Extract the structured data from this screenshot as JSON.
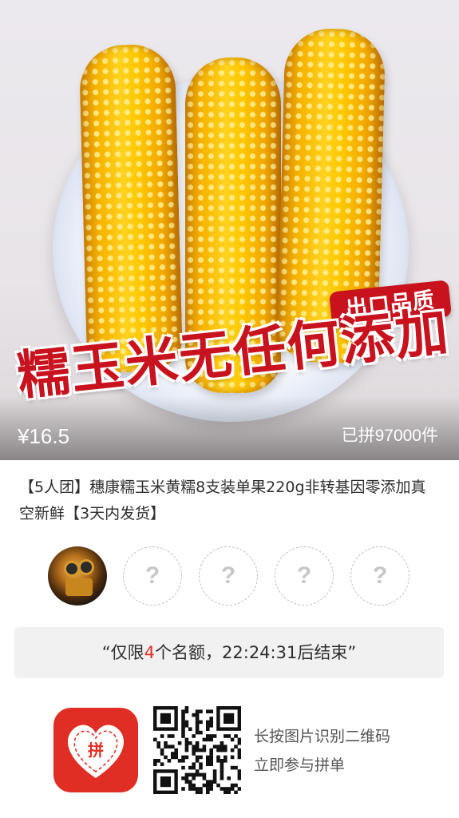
{
  "product": {
    "image_overlay": {
      "badge": "出口品质",
      "slogan": "糯玉米无任何添加"
    },
    "price": "¥16.5",
    "sold_count": "已拼97000件",
    "title": "【5人团】穗康糯玉米黄糯8支装单果220g非转基因零添加真空新鲜【3天内发货】"
  },
  "group": {
    "members": [
      {
        "type": "avatar",
        "icon": "robot-avatar-icon"
      },
      {
        "type": "empty",
        "placeholder": "?"
      },
      {
        "type": "empty",
        "placeholder": "?"
      },
      {
        "type": "empty",
        "placeholder": "?"
      },
      {
        "type": "empty",
        "placeholder": "?"
      }
    ],
    "countdown": {
      "prefix": "“仅限",
      "spots": "4",
      "middle": "个名额，",
      "time": "22:24:31",
      "suffix": "后结束”"
    }
  },
  "footer": {
    "app_icon": "pinduoduo-logo-icon",
    "app_logo_text": "拼",
    "qr_icon": "qr-code-icon",
    "hint_line1": "长按图片识别二维码",
    "hint_line2": "立即参与拼单"
  },
  "colors": {
    "accent_red": "#e02e24",
    "banner_bg": "#f1f1f1",
    "badge_red": "#c8121d"
  }
}
